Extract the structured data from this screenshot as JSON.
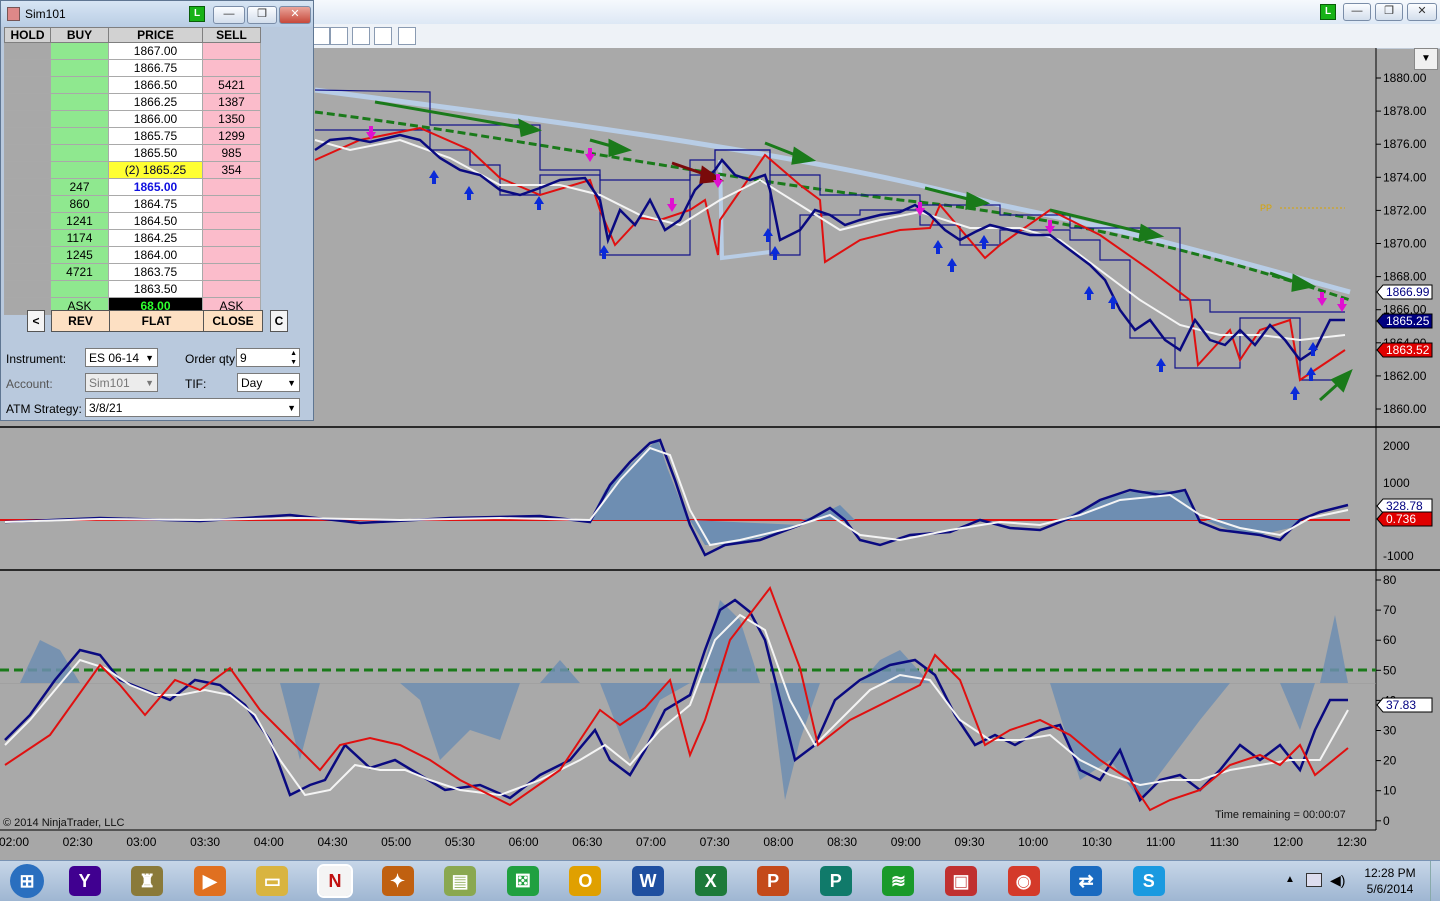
{
  "chart_window": {
    "title_badge": "L",
    "copyright": "© 2014 NinjaTrader, LLC",
    "time_remaining": "Time remaining = 00:00:07",
    "pp_label": "PP"
  },
  "dom": {
    "title": "Sim101",
    "badge": "L",
    "headers": {
      "hold": "HOLD",
      "buy": "BUY",
      "price": "PRICE",
      "sell": "SELL"
    },
    "rows": [
      {
        "buy": "",
        "price": "1867.00",
        "sell": ""
      },
      {
        "buy": "",
        "price": "1866.75",
        "sell": ""
      },
      {
        "buy": "",
        "price": "1866.50",
        "sell": "5421"
      },
      {
        "buy": "",
        "price": "1866.25",
        "sell": "1387"
      },
      {
        "buy": "",
        "price": "1866.00",
        "sell": "1350"
      },
      {
        "buy": "",
        "price": "1865.75",
        "sell": "1299"
      },
      {
        "buy": "",
        "price": "1865.50",
        "sell": "985"
      },
      {
        "buy": "",
        "price": "(2) 1865.25",
        "sell": "354"
      },
      {
        "buy": "247",
        "price": "1865.00",
        "sell": ""
      },
      {
        "buy": "860",
        "price": "1864.75",
        "sell": ""
      },
      {
        "buy": "1241",
        "price": "1864.50",
        "sell": ""
      },
      {
        "buy": "1174",
        "price": "1864.25",
        "sell": ""
      },
      {
        "buy": "1245",
        "price": "1864.00",
        "sell": ""
      },
      {
        "buy": "4721",
        "price": "1863.75",
        "sell": ""
      },
      {
        "buy": "",
        "price": "1863.50",
        "sell": ""
      }
    ],
    "footer": {
      "buy": "ASK",
      "value": "68.00",
      "sell": "ASK"
    },
    "buttons": {
      "left": "<",
      "rev": "REV",
      "flat": "FLAT",
      "close": "CLOSE",
      "c": "C"
    },
    "form": {
      "instrument_label": "Instrument:",
      "instrument_value": "ES 06-14",
      "orderqty_label": "Order qty:",
      "orderqty_value": "9",
      "account_label": "Account:",
      "account_value": "Sim101",
      "tif_label": "TIF:",
      "tif_value": "Day",
      "atm_label": "ATM Strategy:",
      "atm_value": "3/8/21"
    }
  },
  "price_axis": {
    "ticks": [
      "1880.00",
      "1878.00",
      "1876.00",
      "1874.00",
      "1872.00",
      "1870.00",
      "1868.00",
      "1866.00",
      "1864.00",
      "1862.00",
      "1860.00"
    ],
    "tags": [
      {
        "text": "1866.99",
        "color": "#ffffff",
        "text_color": "#000080"
      },
      {
        "text": "1865.25",
        "color": "#000080",
        "text_color": "#ffffff"
      },
      {
        "text": "1863.52",
        "color": "#e00000",
        "text_color": "#ffffff"
      }
    ]
  },
  "osc1_axis": {
    "ticks": [
      "2000",
      "1000",
      "-1000"
    ],
    "tags": [
      {
        "text": "328.78",
        "color": "#ffffff",
        "text_color": "#000080"
      },
      {
        "text": "0.736",
        "color": "#e00000",
        "text_color": "#ffffff"
      }
    ]
  },
  "osc2_axis": {
    "ticks": [
      "80",
      "70",
      "60",
      "50",
      "40",
      "30",
      "20",
      "10",
      "0"
    ],
    "tags": [
      {
        "text": "37.83",
        "color": "#ffffff",
        "text_color": "#000080"
      }
    ]
  },
  "time_axis": {
    "ticks": [
      "02:00",
      "02:30",
      "03:00",
      "03:30",
      "04:00",
      "04:30",
      "05:00",
      "05:30",
      "06:00",
      "06:30",
      "07:00",
      "07:30",
      "08:00",
      "08:30",
      "09:00",
      "09:30",
      "10:00",
      "10:30",
      "11:00",
      "11:30",
      "12:00",
      "12:30"
    ]
  },
  "chart_data": [
    {
      "type": "line",
      "x": [
        "04:15",
        "04:30",
        "05:00",
        "05:30",
        "06:00",
        "06:30",
        "07:00",
        "07:30",
        "08:00",
        "08:30",
        "09:00",
        "09:30",
        "10:00",
        "10:30",
        "11:00",
        "11:30",
        "12:00",
        "12:30"
      ],
      "series": [],
      "ylim": [
        1859,
        1881
      ]
    },
    {
      "type": "line",
      "ylim": [
        -1500,
        2500
      ]
    },
    {
      "type": "line",
      "ylim": [
        0,
        80
      ],
      "reference_line": 50
    }
  ],
  "taskbar": {
    "clock_time": "12:28 PM",
    "clock_date": "5/6/2014",
    "apps": [
      {
        "icon": "start-orb",
        "color": "#2a6fbf",
        "glyph": "⊞"
      },
      {
        "icon": "yahoo-icon",
        "color": "#400090",
        "glyph": "Y"
      },
      {
        "icon": "game-icon",
        "color": "#8a7a3a",
        "glyph": "♜"
      },
      {
        "icon": "media-player-icon",
        "color": "#e07020",
        "glyph": "▶"
      },
      {
        "icon": "file-explorer-icon",
        "color": "#d9b440",
        "glyph": "▭"
      },
      {
        "icon": "ninjatrader-icon",
        "color": "#c01010",
        "glyph": "N"
      },
      {
        "icon": "compass-icon",
        "color": "#c06010",
        "glyph": "✦"
      },
      {
        "icon": "notes-icon",
        "color": "#8aa850",
        "glyph": "▤"
      },
      {
        "icon": "dice-icon",
        "color": "#20a040",
        "glyph": "⚄"
      },
      {
        "icon": "outlook-icon",
        "color": "#e0a000",
        "glyph": "O"
      },
      {
        "icon": "word-icon",
        "color": "#1f4fa0",
        "glyph": "W"
      },
      {
        "icon": "excel-icon",
        "color": "#1d7a3a",
        "glyph": "X"
      },
      {
        "icon": "powerpoint-icon",
        "color": "#c44a1a",
        "glyph": "P"
      },
      {
        "icon": "publisher-icon",
        "color": "#107a6a",
        "glyph": "P"
      },
      {
        "icon": "spotify-icon",
        "color": "#1a9a2a",
        "glyph": "≋"
      },
      {
        "icon": "pdf-icon",
        "color": "#c03030",
        "glyph": "▣"
      },
      {
        "icon": "chrome-icon",
        "color": "#d43a2a",
        "glyph": "◉"
      },
      {
        "icon": "teamviewer-icon",
        "color": "#1a6ac0",
        "glyph": "⇄"
      },
      {
        "icon": "skype-icon",
        "color": "#1a9ae0",
        "glyph": "S"
      }
    ]
  }
}
